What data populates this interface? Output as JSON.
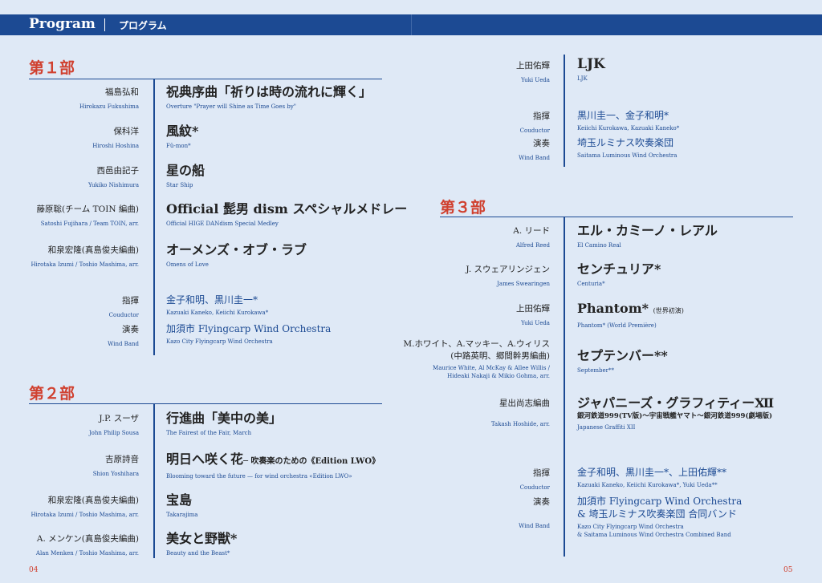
{
  "header": {
    "title": "Program",
    "subtitle": "プログラム"
  },
  "left": {
    "part1": {
      "heading": "第１部",
      "items": [
        {
          "composer_jp": "福島弘和",
          "composer_en": "Hirokazu Fukushima",
          "title_jp": "祝典序曲「祈りは時の流れに輝く」",
          "title_en": "Overture \"Prayer will Shine as Time Goes by\""
        },
        {
          "composer_jp": "保科洋",
          "composer_en": "Hiroshi Hoshina",
          "title_jp": "風紋*",
          "title_en": "Fû-mon*"
        },
        {
          "composer_jp": "西邑由記子",
          "composer_en": "Yukiko Nishimura",
          "title_jp": "星の船",
          "title_en": "Star Ship"
        },
        {
          "composer_jp": "藤原聡(チーム TOIN 編曲)",
          "composer_en": "Satoshi Fujihara / Team TOIN, arr.",
          "title_jp": "Official 髭男 dism スペシャルメドレー",
          "title_en": "Official HIGE DANdism Special Medley"
        },
        {
          "composer_jp": "和泉宏隆(真島俊夫編曲)",
          "composer_en": "Hirotaka Izumi / Toshio Mashima, arr.",
          "title_jp": "オーメンズ・オブ・ラブ",
          "title_en": "Omens of Love"
        }
      ],
      "conductor_label_jp": "指揮",
      "conductor_label_en": "Couductor",
      "conductor_jp": "金子和明、黒川圭一*",
      "conductor_en": "Kazuaki Kaneko, Keiichi Kurokawa*",
      "band_label_jp": "演奏",
      "band_label_en": "Wind Band",
      "band_jp": "加須市 Flyingcarp Wind Orchestra",
      "band_en": "Kazo City Flyingcarp Wind Orchestra"
    },
    "part2": {
      "heading": "第２部",
      "items": [
        {
          "composer_jp": "J.P. スーザ",
          "composer_en": "John Philip Sousa",
          "title_jp": "行進曲「美中の美」",
          "title_en": "The Fairest of the Fair, March"
        },
        {
          "composer_jp": "吉原詩音",
          "composer_en": "Shion Yoshihara",
          "title_jp": "明日へ咲く花",
          "title_sub": "─ 吹奏楽のための《Edition LWO》",
          "title_en": "Blooming toward the future — for wind orchestra «Edition LWO»"
        },
        {
          "composer_jp": "和泉宏隆(真島俊夫編曲)",
          "composer_en": "Hirotaka Izumi / Toshio Mashima, arr.",
          "title_jp": "宝島",
          "title_en": "Takarajima"
        },
        {
          "composer_jp": "A. メンケン(真島俊夫編曲)",
          "composer_en": "Alan Menken / Toshio Mashima, arr.",
          "title_jp": "美女と野獣*",
          "title_en": "Beauty and the Beast*"
        }
      ]
    },
    "page_number": "04"
  },
  "right": {
    "part2_cont": {
      "item": {
        "composer_jp": "上田佑輝",
        "composer_en": "Yuki Ueda",
        "title_jp": "LJK",
        "title_en": "LJK"
      },
      "conductor_label_jp": "指揮",
      "conductor_label_en": "Couductor",
      "conductor_jp": "黒川圭一、金子和明*",
      "conductor_en": "Keiichi Kurokawa, Kazuaki Kaneko*",
      "band_label_jp": "演奏",
      "band_label_en": "Wind Band",
      "band_jp": "埼玉ルミナス吹奏楽団",
      "band_en": "Saitama Luminous Wind Orchestra"
    },
    "part3": {
      "heading": "第３部",
      "items": [
        {
          "composer_jp": "A. リード",
          "composer_en": "Alfred Reed",
          "title_jp": "エル・カミーノ・レアル",
          "title_en": "El Camino Real"
        },
        {
          "composer_jp": "J. スウェアリンジェン",
          "composer_en": "James Swearingen",
          "title_jp": "センチュリア*",
          "title_en": "Centuria*"
        },
        {
          "composer_jp": "上田佑輝",
          "composer_en": "Yuki Ueda",
          "title_jp": "Phantom*",
          "title_sub": "(世界初演)",
          "title_en": "Phantom* (World Première)"
        },
        {
          "composer_jp": "M.ホワイト、A.マッキー、A.ウィリス",
          "composer_jp_line2": "(中路英明、郷間幹男編曲)",
          "composer_en": "Maurice White, Al McKay & Allee Willis /",
          "composer_en_line2": "Hideaki Nakaji & Mikio Gohma, arr.",
          "title_jp": "セプテンバー**",
          "title_en": "September**"
        },
        {
          "composer_jp": "星出尚志編曲",
          "composer_en": "Takash Hoshide, arr.",
          "title_jp": "ジャパニーズ・グラフィティーⅫ",
          "title_jp_line2": "銀河鉄道999(TV版)〜宇宙戦艦ヤマト〜銀河鉄道999(劇場版)",
          "title_en": "Japanese Graffiti XII"
        }
      ],
      "conductor_label_jp": "指揮",
      "conductor_label_en": "Couductor",
      "conductor_jp": "金子和明、黒川圭一*、上田佑輝**",
      "conductor_en": "Kazuaki Kaneko, Keiichi Kurokawa*, Yuki Ueda**",
      "band_label_jp": "演奏",
      "band_label_en": "Wind Band",
      "band_jp": "加須市 Flyingcarp Wind Orchestra",
      "band_jp_line2": "& 埼玉ルミナス吹奏楽団 合同バンド",
      "band_en": "Kazo City Flyingcarp Wind Orchestra",
      "band_en_line2": "& Saitama Luminous Wind Orchestra Combined Band"
    },
    "page_number": "05"
  }
}
